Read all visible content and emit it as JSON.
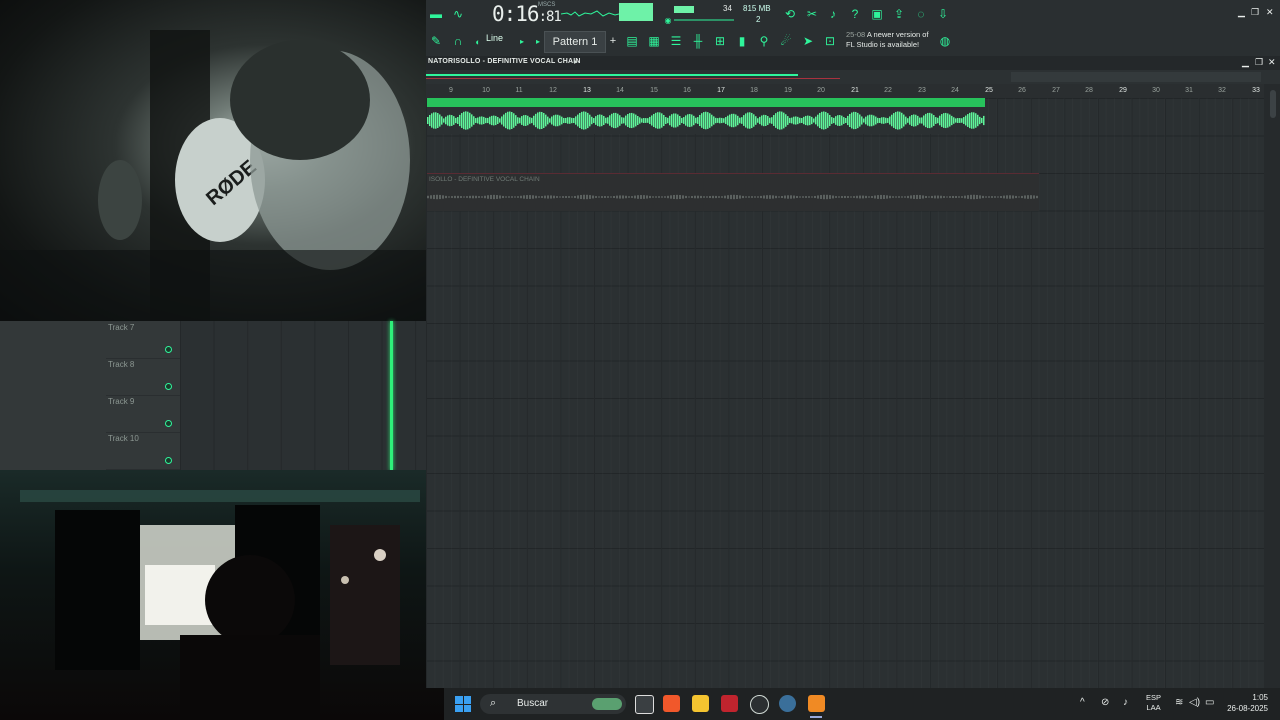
{
  "app": {
    "transport": {
      "time_main": "0:16",
      "time_ms": ":81",
      "time_label": "MSCS"
    },
    "memory": "815 MB",
    "polyphony": "2",
    "cpu_value": "34",
    "mode_select": "Line",
    "pattern": "Pattern 1",
    "update_notice": {
      "version": "25-08",
      "line1": "A newer version of",
      "line2": "FL Studio is available!"
    }
  },
  "playlist": {
    "title": "NATORISOLLO - DEFINITIVE VOCAL CHAIN",
    "ruler": [
      "9",
      "10",
      "11",
      "12",
      "13",
      "14",
      "15",
      "16",
      "17",
      "18",
      "19",
      "20",
      "21",
      "22",
      "23",
      "24",
      "25",
      "26",
      "27",
      "28",
      "29",
      "30",
      "31",
      "32",
      "33"
    ],
    "clip2_label": "ISOLLO - DEFINITIVE VOCAL CHAIN"
  },
  "tracks": [
    "Track 7",
    "Track 8",
    "Track 9",
    "Track 10"
  ],
  "webcam": {
    "mic_brand": "RØDE"
  },
  "taskbar": {
    "search_placeholder": "Buscar",
    "lang_top": "ESP",
    "lang_bottom": "LAA",
    "time": "1:05",
    "date": "26-08-2025"
  },
  "colors": {
    "accent": "#2ff59b",
    "clip": "#27c25b",
    "waveform": "#5ff59a",
    "playhead": "#2ef07a"
  }
}
